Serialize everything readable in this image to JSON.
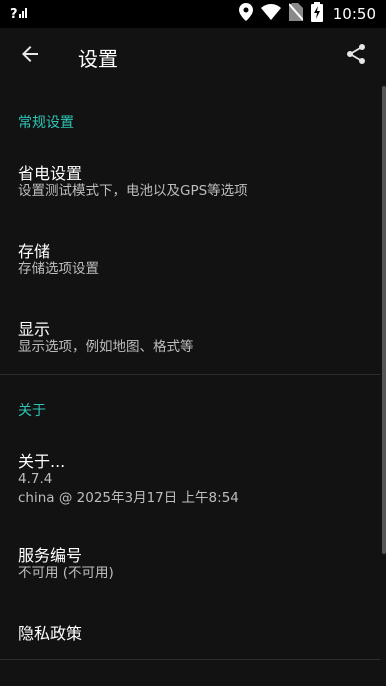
{
  "status_bar": {
    "signal_text": "?",
    "time": "10:50",
    "icons": [
      "signal-icon",
      "location-icon",
      "wifi-icon",
      "no-sim-icon",
      "battery-charging-icon"
    ]
  },
  "app_bar": {
    "title": "设置",
    "back_icon": "arrow-back-icon",
    "share_icon": "share-icon"
  },
  "sections": [
    {
      "title": "常规设置",
      "items": [
        {
          "title": "省电设置",
          "summary": "设置测试模式下，电池以及GPS等选项"
        },
        {
          "title": "存储",
          "summary": "存储选项设置"
        },
        {
          "title": "显示",
          "summary": "显示选项，例如地图、格式等"
        }
      ]
    },
    {
      "title": "关于",
      "items": [
        {
          "title": "关于...",
          "summary_line1": "4.7.4",
          "summary_line2": "china @ 2025年3月17日 上午8:54"
        },
        {
          "title": "服务编号",
          "summary": "不可用 (不可用)"
        },
        {
          "title": "隐私政策"
        }
      ]
    }
  ],
  "colors": {
    "background": "#121212",
    "status_bar": "#000000",
    "accent": "#2ec4b6",
    "summary_text": "#bdbdbd",
    "divider": "#2e2e2e"
  }
}
